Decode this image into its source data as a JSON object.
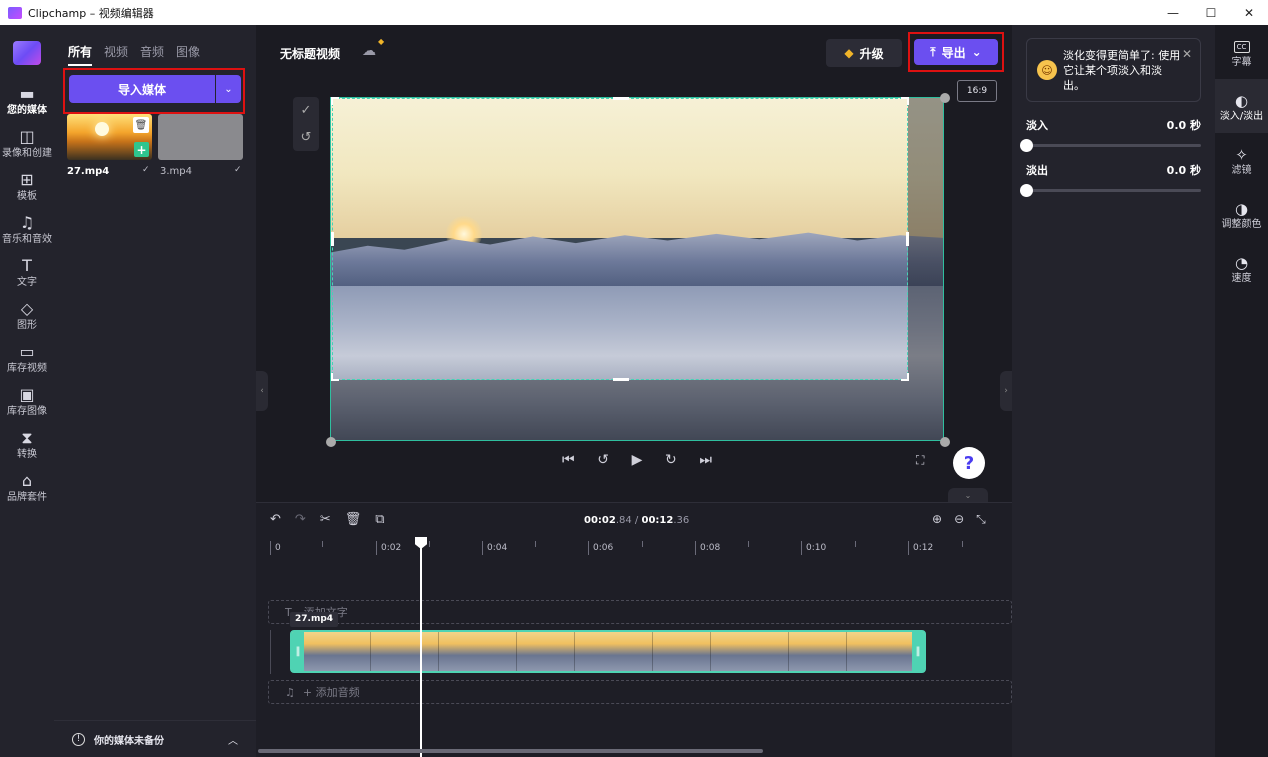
{
  "window": {
    "title": "Clipchamp – 视频编辑器",
    "controls": [
      "—",
      "☐",
      "✕"
    ]
  },
  "leftnav": {
    "items": [
      {
        "label": "您的媒体",
        "icon": "folder-icon",
        "glyph": "▬"
      },
      {
        "label": "录像和创建",
        "icon": "camera-icon",
        "glyph": "◫"
      },
      {
        "label": "模板",
        "icon": "template-icon",
        "glyph": "⊞"
      },
      {
        "label": "音乐和音效",
        "icon": "music-icon",
        "glyph": "♫"
      },
      {
        "label": "文字",
        "icon": "text-icon",
        "glyph": "T"
      },
      {
        "label": "图形",
        "icon": "shapes-icon",
        "glyph": "◇"
      },
      {
        "label": "库存视频",
        "icon": "stock-video-icon",
        "glyph": "▭"
      },
      {
        "label": "库存图像",
        "icon": "stock-image-icon",
        "glyph": "▣"
      },
      {
        "label": "转换",
        "icon": "transition-icon",
        "glyph": "⧗"
      },
      {
        "label": "品牌套件",
        "icon": "brand-kit-icon",
        "glyph": "⌂"
      }
    ]
  },
  "media": {
    "tabs": [
      "所有",
      "视频",
      "音频",
      "图像"
    ],
    "import_label": "导入媒体",
    "files": [
      {
        "name": "27.mp4",
        "check": "✓"
      },
      {
        "name": "3.mp4",
        "check": "✓"
      }
    ],
    "backup_text": "你的媒体未备份"
  },
  "header": {
    "project_title": "无标题视频",
    "upgrade_label": "升级",
    "export_label": "导出",
    "aspect_ratio": "16:9"
  },
  "timeline": {
    "current_time": "00:02",
    "current_frac": ".84",
    "separator": " / ",
    "total_time": "00:12",
    "total_frac": ".36",
    "ticks": [
      "0",
      "0:02",
      "0:04",
      "0:06",
      "0:08",
      "0:10",
      "0:12"
    ],
    "add_text": "添加文字",
    "clip_name": "27.mp4",
    "add_audio": "+ 添加音频"
  },
  "props": {
    "tip": "淡化变得更简单了: 使用它让某个项淡入和淡出。",
    "fade_in_label": "淡入",
    "fade_in_value": "0.0 秒",
    "fade_out_label": "淡出",
    "fade_out_value": "0.0 秒"
  },
  "rightrail": {
    "items": [
      {
        "label": "字幕",
        "icon": "captions-icon"
      },
      {
        "label": "淡入/淡出",
        "icon": "fade-icon"
      },
      {
        "label": "滤镜",
        "icon": "filter-icon"
      },
      {
        "label": "调整颜色",
        "icon": "adjust-color-icon"
      },
      {
        "label": "速度",
        "icon": "speed-icon"
      }
    ]
  },
  "colors": {
    "accent": "#6b4ff0",
    "highlight_box": "#dd1111",
    "clip_border": "#4fd3b3"
  }
}
